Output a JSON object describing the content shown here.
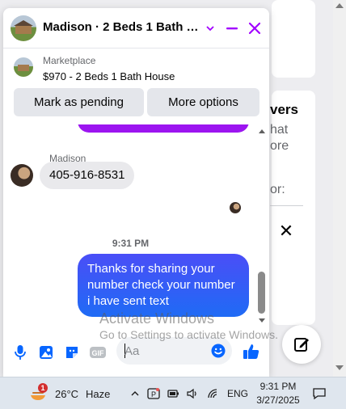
{
  "background": {
    "partial_heading": "vers",
    "partial_line1": "hat",
    "partial_line2": "ore",
    "partial_line3": "or:"
  },
  "chat": {
    "title": "Madison · 2 Beds 1 Bath House",
    "listing_label": "Marketplace",
    "listing_title": "$970 - 2 Beds 1 Bath House",
    "mark_pending_label": "Mark as pending",
    "more_options_label": "More options",
    "sender_name": "Madison",
    "their_message": "405-916-8531",
    "timestamp": "9:31 PM",
    "my_message": "Thanks for sharing your number check your number i have sent text",
    "composer_placeholder": "Aa",
    "composer_value": "",
    "accent_color": "#a100ff",
    "messenger_blue": "#0866ff"
  },
  "watermark": {
    "line1": "Activate Windows",
    "line2": "Go to Settings to activate Windows."
  },
  "taskbar": {
    "notification_count": "1",
    "temperature": "26°C",
    "weather": "Haze",
    "language": "ENG",
    "time": "9:31 PM",
    "date": "3/27/2025"
  },
  "icons": [
    "minimize-icon",
    "close-icon",
    "chevron-down-icon",
    "microphone-icon",
    "image-icon",
    "sticker-icon",
    "gif-icon",
    "emoji-icon",
    "thumbs-up-icon",
    "compose-icon",
    "weather-icon",
    "wifi-icon",
    "volume-icon",
    "battery-icon",
    "notification-icon"
  ]
}
